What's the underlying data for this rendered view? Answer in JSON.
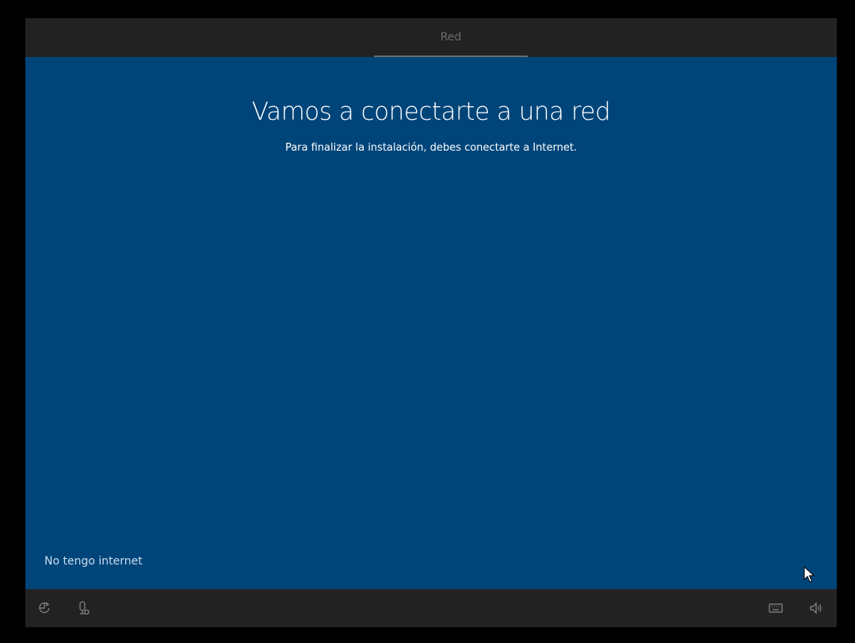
{
  "header": {
    "tab_label": "Red"
  },
  "main": {
    "title": "Vamos a conectarte a una red",
    "subtitle": "Para finalizar la instalación, debes conectarte a Internet.",
    "skip_link": "No tengo internet"
  },
  "footer": {
    "icons": [
      "ease-of-access-icon",
      "microphone-icon",
      "keyboard-icon",
      "volume-icon"
    ]
  },
  "colors": {
    "background": "#00457a",
    "bars": "#222222",
    "link": "#c9dcee"
  }
}
